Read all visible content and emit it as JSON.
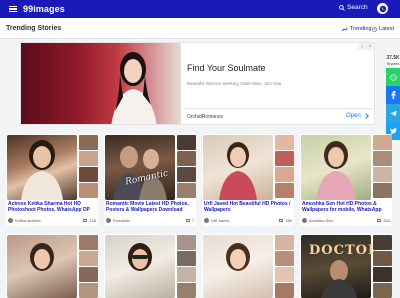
{
  "header": {
    "brand": "99images",
    "search_label": "Search"
  },
  "section": {
    "title": "Trending Stories",
    "tab_trending": "Trending",
    "tab_latest": "Latest"
  },
  "ad": {
    "headline": "Find Your Soulmate",
    "subtext": "Beautiful Women Seeking Older Men, Join now",
    "source": "OrchidRomance",
    "cta": "Open"
  },
  "share": {
    "count": "37.5K",
    "count_label": "Shares"
  },
  "cards": [
    {
      "title": "Actress Ketika Sharma Hot HD Photoshoot Photos, WhatsApp DP",
      "author": "Ketika sharma",
      "count": "128"
    },
    {
      "title": "Romantic Movie Latest HD Photos, Posters & Wallpapers Download",
      "author": "Romantic",
      "count": "7"
    },
    {
      "title": "Urfi Javed Hot Beautiful HD Photos / Wallpapers",
      "author": "Urfi Javed",
      "count": "180"
    },
    {
      "title": "Amoshka Sen Hot HD Photos & Wallpapers for mobile, WhatsApp",
      "author": "Anushka Sen",
      "count": "332"
    }
  ],
  "poster_texts": {
    "romantic": "Romantic",
    "doctor": "DOCTOR"
  },
  "colors": {
    "header_bg": "#1a1ab8",
    "title_link": "#1a1ab8",
    "whatsapp": "#25d366",
    "facebook": "#1877f2",
    "telegram": "#2ca5e0",
    "twitter": "#1da1f2"
  }
}
